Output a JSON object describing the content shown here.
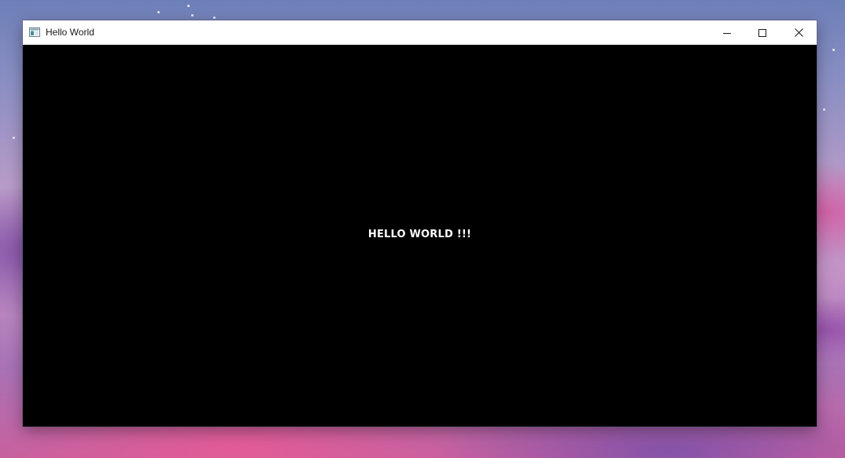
{
  "window": {
    "title": "Hello World",
    "icon": "app-window-icon",
    "controls": {
      "minimize_icon": "minimize-icon",
      "maximize_icon": "maximize-icon",
      "close_icon": "close-icon"
    }
  },
  "content": {
    "message": "HELLO WORLD !!!",
    "background_color": "#000000",
    "text_color": "#ffffff"
  },
  "colors": {
    "titlebar": "#ffffff",
    "title_text": "#1a1a1a"
  }
}
